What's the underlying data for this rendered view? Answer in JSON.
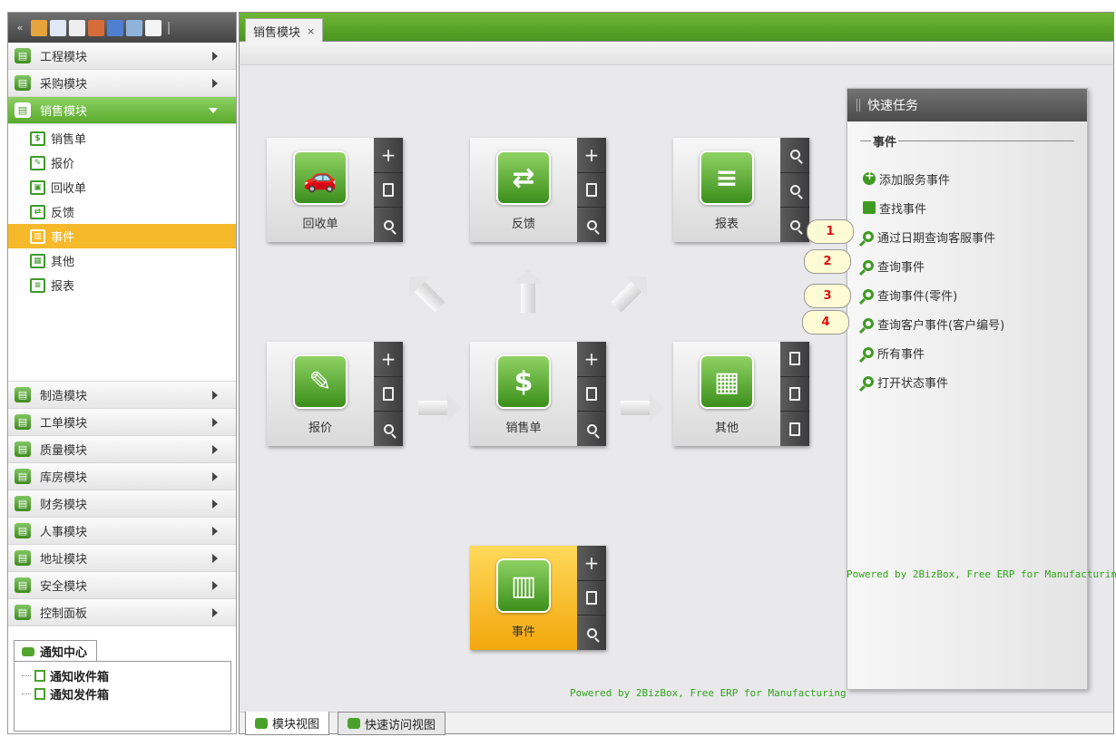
{
  "toolbar": {
    "icons": [
      "collapse-icon",
      "users-icon",
      "mail-icon",
      "document-icon",
      "chart-icon",
      "monitor-icon",
      "network-icon",
      "home-icon"
    ]
  },
  "sidebar": {
    "modules_top": [
      {
        "label": "工程模块",
        "icon": "engineering-icon"
      },
      {
        "label": "采购模块",
        "icon": "purchasing-icon"
      },
      {
        "label": "销售模块",
        "icon": "sales-icon",
        "active": true
      }
    ],
    "sub_items": [
      {
        "label": "销售单",
        "icon": "sales-order-icon",
        "glyph": "$"
      },
      {
        "label": "报价",
        "icon": "quote-icon",
        "glyph": "✎"
      },
      {
        "label": "回收单",
        "icon": "return-icon",
        "glyph": "▣"
      },
      {
        "label": "反馈",
        "icon": "feedback-icon",
        "glyph": "⇄"
      },
      {
        "label": "事件",
        "icon": "event-icon",
        "glyph": "▥",
        "selected": true
      },
      {
        "label": "其他",
        "icon": "other-icon",
        "glyph": "▦"
      },
      {
        "label": "报表",
        "icon": "report-icon",
        "glyph": "≡"
      }
    ],
    "modules_bottom": [
      {
        "label": "制造模块",
        "icon": "manufacturing-icon"
      },
      {
        "label": "工单模块",
        "icon": "work-order-icon"
      },
      {
        "label": "质量模块",
        "icon": "quality-icon"
      },
      {
        "label": "库房模块",
        "icon": "warehouse-icon"
      },
      {
        "label": "财务模块",
        "icon": "finance-icon"
      },
      {
        "label": "人事模块",
        "icon": "hr-icon"
      },
      {
        "label": "地址模块",
        "icon": "address-icon"
      },
      {
        "label": "安全模块",
        "icon": "security-icon"
      },
      {
        "label": "控制面板",
        "icon": "control-panel-icon"
      }
    ]
  },
  "notification": {
    "tab_label": "通知中心",
    "items": [
      "通知收件箱",
      "通知发件箱"
    ]
  },
  "main_tab": {
    "label": "销售模块",
    "close": "×"
  },
  "tiles": {
    "return": {
      "label": "回收单",
      "glyph": "🚗"
    },
    "feedback": {
      "label": "反馈",
      "glyph": "⇄"
    },
    "report": {
      "label": "报表",
      "glyph": "≡"
    },
    "quote": {
      "label": "报价",
      "glyph": "✎"
    },
    "sales_order": {
      "label": "销售单",
      "glyph": "$"
    },
    "other": {
      "label": "其他",
      "glyph": "▦"
    },
    "event": {
      "label": "事件",
      "glyph": "▥"
    }
  },
  "quick_tasks": {
    "title": "快速任务",
    "section": "事件",
    "links": [
      {
        "label": "添加服务事件",
        "icon": "add-icon"
      },
      {
        "label": "查找事件",
        "icon": "find-icon"
      },
      {
        "label": "通过日期查询客服事件",
        "icon": "search-icon"
      },
      {
        "label": "查询事件",
        "icon": "search-icon"
      },
      {
        "label": "查询事件(零件)",
        "icon": "search-icon"
      },
      {
        "label": "查询客户事件(客户编号)",
        "icon": "search-icon"
      },
      {
        "label": "所有事件",
        "icon": "search-icon"
      },
      {
        "label": "打开状态事件",
        "icon": "search-icon"
      }
    ]
  },
  "badges": [
    "1",
    "2",
    "3",
    "4"
  ],
  "powered_by": "Powered by 2BizBox, Free ERP for Manufacturing",
  "view_tabs": [
    "模块视图",
    "快速访问视图"
  ],
  "colors": {
    "accent_green": "#5aab2c",
    "selected_orange": "#f6b92a",
    "badge_red": "#dd1111"
  }
}
